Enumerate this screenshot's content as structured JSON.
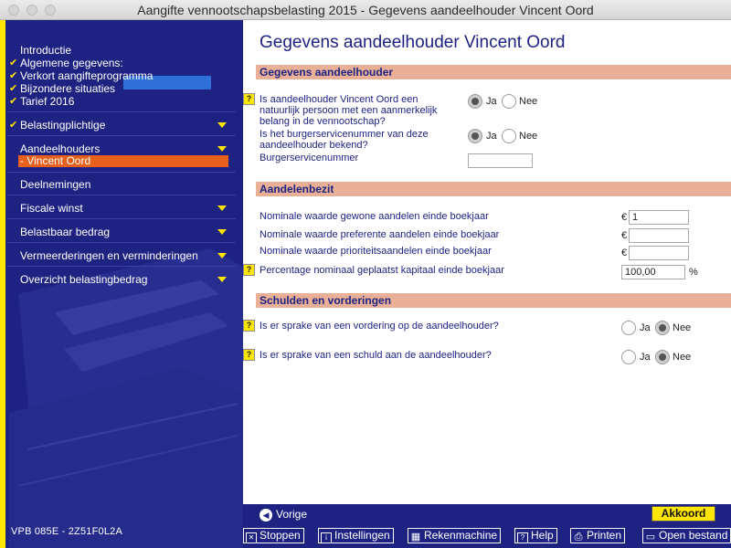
{
  "window": {
    "title": "Aangifte vennootschapsbelasting 2015 - Gegevens aandeelhouder Vincent Oord"
  },
  "sidebar": {
    "items": [
      {
        "label": "Introductie",
        "checked": false,
        "arrow": false
      },
      {
        "label": "Algemene gegevens:",
        "checked": true,
        "arrow": false
      },
      {
        "label": "Verkort aangifteprogramma",
        "checked": true,
        "arrow": false
      },
      {
        "label": "Bijzondere situaties",
        "checked": true,
        "arrow": false
      },
      {
        "label": "Tarief 2016",
        "checked": true,
        "arrow": false
      },
      {
        "label": "Belastingplichtige",
        "checked": true,
        "arrow": true
      },
      {
        "label": "Aandeelhouders",
        "checked": false,
        "arrow": true
      },
      {
        "label": "Deelnemingen",
        "checked": false,
        "arrow": false
      },
      {
        "label": "Fiscale winst",
        "checked": false,
        "arrow": true
      },
      {
        "label": "Belastbaar bedrag",
        "checked": false,
        "arrow": true
      },
      {
        "label": "Vermeerderingen en verminderingen",
        "checked": false,
        "arrow": true
      },
      {
        "label": "Overzicht belastingbedrag",
        "checked": false,
        "arrow": true
      }
    ],
    "sub_item": "- Vincent Oord",
    "version": "VPB 085E - 2Z51F0L2A"
  },
  "main": {
    "page_title": "Gegevens aandeelhouder Vincent Oord",
    "section1": {
      "title": "Gegevens aandeelhouder",
      "q1": "Is aandeelhouder Vincent Oord een natuurlijk persoon met een aanmerkelijk belang in de vennootschap?",
      "q2": "Is het burgerservicenummer van deze aandeelhouder bekend?",
      "bsn_label": "Burgerservicenummer",
      "bsn_value": ""
    },
    "section2": {
      "title": "Aandelenbezit",
      "r1": "Nominale waarde gewone aandelen einde boekjaar",
      "r1_value": "1",
      "r2": "Nominale waarde preferente aandelen einde boekjaar",
      "r2_value": "",
      "r3": "Nominale waarde prioriteitsaandelen einde boekjaar",
      "r3_value": "",
      "r4": "Percentage nominaal geplaatst kapitaal einde boekjaar",
      "r4_value": "100,00",
      "currency": "€",
      "percent": "%"
    },
    "section3": {
      "title": "Schulden en vorderingen",
      "q1": "Is er sprake van een vordering op de aandeelhouder?",
      "q2": "Is er sprake van een schuld aan de aandeelhouder?"
    },
    "yes_label": "Ja",
    "no_label": "Nee",
    "help_label": "?"
  },
  "nav": {
    "back_label": "Vorige",
    "ok_label": "Akkoord"
  },
  "toolbar": {
    "stop": "Stoppen",
    "settings": "Instellingen",
    "calculator": "Rekenmachine",
    "help": "Help",
    "print": "Printen",
    "open_file": "Open bestand"
  }
}
